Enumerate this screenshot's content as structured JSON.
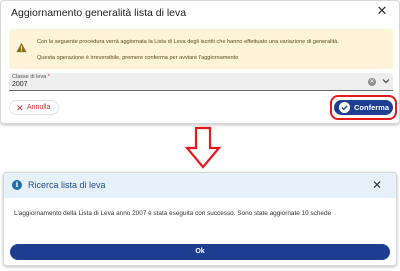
{
  "confirm_dialog": {
    "title": "Aggiornamento generalità lista di leva",
    "close_icon": "close-icon",
    "warning": {
      "icon": "warning-icon",
      "line1": "Con la seguente procedura verrà aggiornata la Lista di Leva degli iscritti che hanno effettuato una variazione di generalità.",
      "line2": "Questa operazione è irreversibile, premere conferma per avviare l'aggiornamento"
    },
    "field": {
      "label": "Classe di leva",
      "required_mark": "*",
      "value": "2007"
    },
    "cancel_label": "Annulla",
    "confirm_label": "Conferma"
  },
  "result_dialog": {
    "title": "Ricerca lista di leva",
    "message": "L'aggiornamento della Lista di Leva anno 2007 è stata eseguita con successo. Sono state aggiornate 10 schede",
    "ok_label": "Ok"
  },
  "colors": {
    "primary": "#1e3f91",
    "danger": "#d32f2f",
    "highlight": "#e5191c",
    "warning_bg": "#fdf3d6",
    "info_bg": "#e6f1fa"
  }
}
